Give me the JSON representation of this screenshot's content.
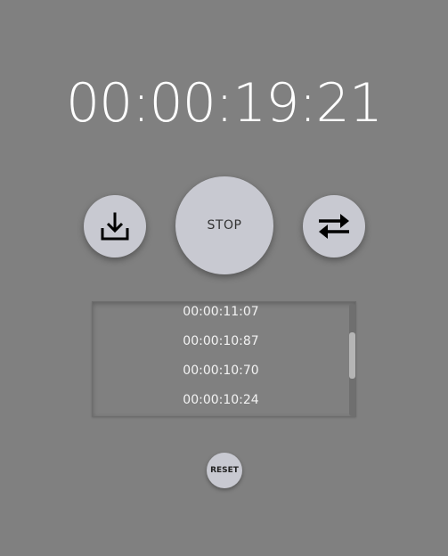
{
  "timer": {
    "display": "00:00:19:21"
  },
  "controls": {
    "download_icon": "download-icon",
    "stop_label": "STOP",
    "swap_icon": "swap-arrows-icon",
    "reset_label": "RESET"
  },
  "laps": [
    "00:00:11:07",
    "00:00:10:87",
    "00:00:10:70",
    "00:00:10:24"
  ],
  "colors": {
    "background": "#808080",
    "button": "#c8c9d1",
    "text": "#ffffff"
  }
}
